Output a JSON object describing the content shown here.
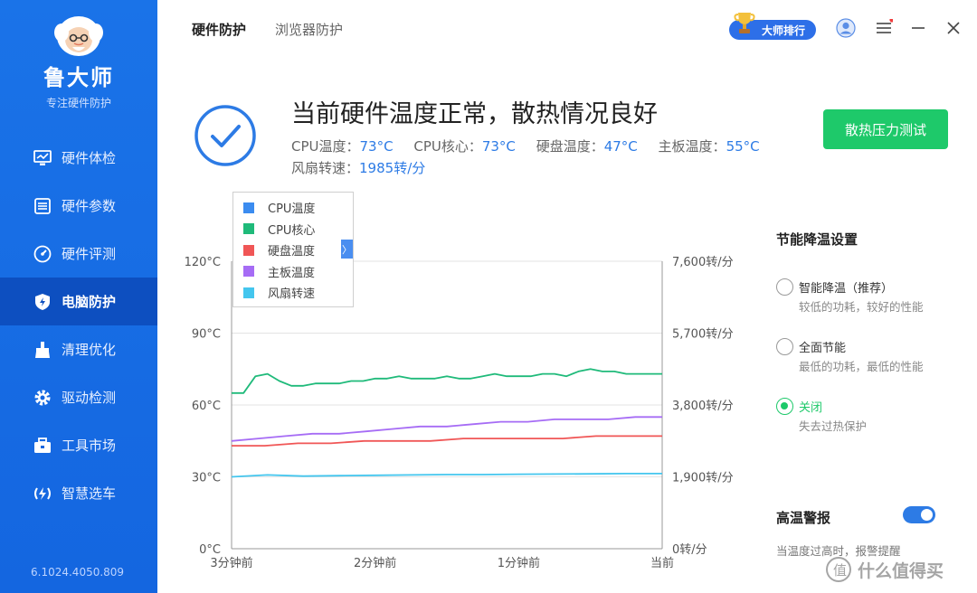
{
  "sidebar": {
    "app_name": "鲁大师",
    "slogan": "专注硬件防护",
    "items": [
      {
        "label": "硬件体检",
        "icon": "monitor-icon"
      },
      {
        "label": "硬件参数",
        "icon": "list-icon"
      },
      {
        "label": "硬件评测",
        "icon": "gauge-icon"
      },
      {
        "label": "电脑防护",
        "icon": "shield-bolt-icon"
      },
      {
        "label": "清理优化",
        "icon": "broom-icon"
      },
      {
        "label": "驱动检测",
        "icon": "gear-icon"
      },
      {
        "label": "工具市场",
        "icon": "toolbox-icon"
      },
      {
        "label": "智慧选车",
        "icon": "car-select-icon"
      }
    ],
    "active_index": 3,
    "version": "6.1024.4050.809"
  },
  "header": {
    "tabs": [
      {
        "label": "硬件防护"
      },
      {
        "label": "浏览器防护"
      }
    ],
    "active_tab": 0,
    "rank_label": "大师排行"
  },
  "status": {
    "title": "当前硬件温度正常，散热情况良好",
    "readings": [
      {
        "label": "CPU温度：",
        "value": "73°C"
      },
      {
        "label": "CPU核心：",
        "value": "73°C"
      },
      {
        "label": "硬盘温度：",
        "value": "47°C"
      },
      {
        "label": "主板温度：",
        "value": "55°C"
      }
    ],
    "fan_label": "风扇转速：",
    "fan_value": "1985转/分",
    "stress_test_label": "散热压力测试"
  },
  "legend": [
    {
      "label": "CPU温度",
      "color": "#3b8cf0"
    },
    {
      "label": "CPU核心",
      "color": "#1fba7a"
    },
    {
      "label": "硬盘温度",
      "color": "#f05656"
    },
    {
      "label": "主板温度",
      "color": "#a66cf5"
    },
    {
      "label": "风扇转速",
      "color": "#44c6ee"
    }
  ],
  "legend_toggle": "〉",
  "chart_data": {
    "type": "line",
    "x": [
      "3分钟前",
      "2分钟前",
      "1分钟前",
      "当前"
    ],
    "y_left_ticks": [
      "0°C",
      "30°C",
      "60°C",
      "90°C",
      "120°C"
    ],
    "y_left_range": [
      0,
      120
    ],
    "y_right_ticks": [
      "0转/分",
      "1,900转/分",
      "3,800转/分",
      "5,700转/分",
      "7,600转/分"
    ],
    "y_right_range": [
      0,
      7600
    ],
    "grid": true,
    "series": [
      {
        "name": "CPU核心",
        "color": "#1fba7a",
        "axis": "left",
        "values": [
          65,
          65,
          72,
          73,
          70,
          68,
          68,
          69,
          69,
          69,
          70,
          70,
          71,
          71,
          72,
          71,
          71,
          71,
          72,
          71,
          71,
          72,
          73,
          72,
          72,
          72,
          73,
          73,
          72,
          74,
          75,
          74,
          74,
          73,
          73,
          73,
          73
        ]
      },
      {
        "name": "主板温度",
        "color": "#a66cf5",
        "axis": "left",
        "values": [
          45,
          46,
          47,
          48,
          48,
          49,
          50,
          51,
          51,
          52,
          53,
          53,
          54,
          54,
          54,
          55,
          55
        ]
      },
      {
        "name": "硬盘温度",
        "color": "#f05656",
        "axis": "left",
        "values": [
          43,
          43,
          44,
          44,
          45,
          45,
          45,
          46,
          46,
          46,
          46,
          47,
          47,
          47
        ]
      },
      {
        "name": "风扇转速",
        "color": "#44c6ee",
        "axis": "right",
        "values": [
          1900,
          1950,
          1920,
          1930,
          1940,
          1950,
          1960,
          1960,
          1970,
          1975,
          1980,
          1985,
          1985
        ]
      }
    ]
  },
  "settings": {
    "title": "节能降温设置",
    "options": [
      {
        "label": "智能降温（推荐）",
        "desc": "较低的功耗，较好的性能",
        "selected": false
      },
      {
        "label": "全面节能",
        "desc": "最低的功耗，最低的性能",
        "selected": false
      },
      {
        "label": "关闭",
        "desc": "失去过热保护",
        "selected": true
      }
    ],
    "alarm_title": "高温警报",
    "alarm_enabled": true,
    "alarm_desc": "当温度过高时，报警提醒"
  },
  "watermark": "什么值得买"
}
